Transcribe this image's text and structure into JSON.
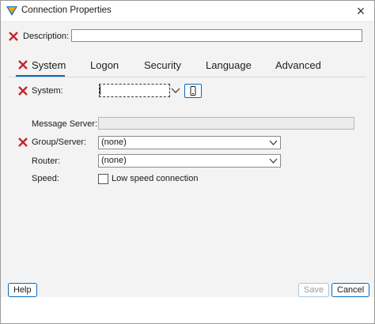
{
  "window": {
    "title": "Connection Properties",
    "close_glyph": "×"
  },
  "description": {
    "label": "Description:",
    "value": ""
  },
  "tabs": [
    {
      "label": "System",
      "active": true,
      "error": true
    },
    {
      "label": "Logon",
      "active": false
    },
    {
      "label": "Security",
      "active": false
    },
    {
      "label": "Language",
      "active": false
    },
    {
      "label": "Advanced",
      "active": false
    }
  ],
  "system_tab": {
    "system": {
      "label": "System:",
      "value": ""
    },
    "message_server": {
      "label": "Message Server:",
      "value": ""
    },
    "group_server": {
      "label": "Group/Server:",
      "value": "(none)"
    },
    "router": {
      "label": "Router:",
      "value": "(none)"
    },
    "speed": {
      "label": "Speed:",
      "checkbox_label": "Low speed connection",
      "checked": false
    }
  },
  "buttons": {
    "help": "Help",
    "save": "Save",
    "cancel": "Cancel"
  },
  "icons": {
    "error": "red-x-icon",
    "dropdown": "chevron-down-icon",
    "device": "mobile-device-icon",
    "app": "sap-logo-icon"
  },
  "colors": {
    "accent": "#0a66c2",
    "error": "#c4262e",
    "content_bg": "#f3f3f3"
  }
}
